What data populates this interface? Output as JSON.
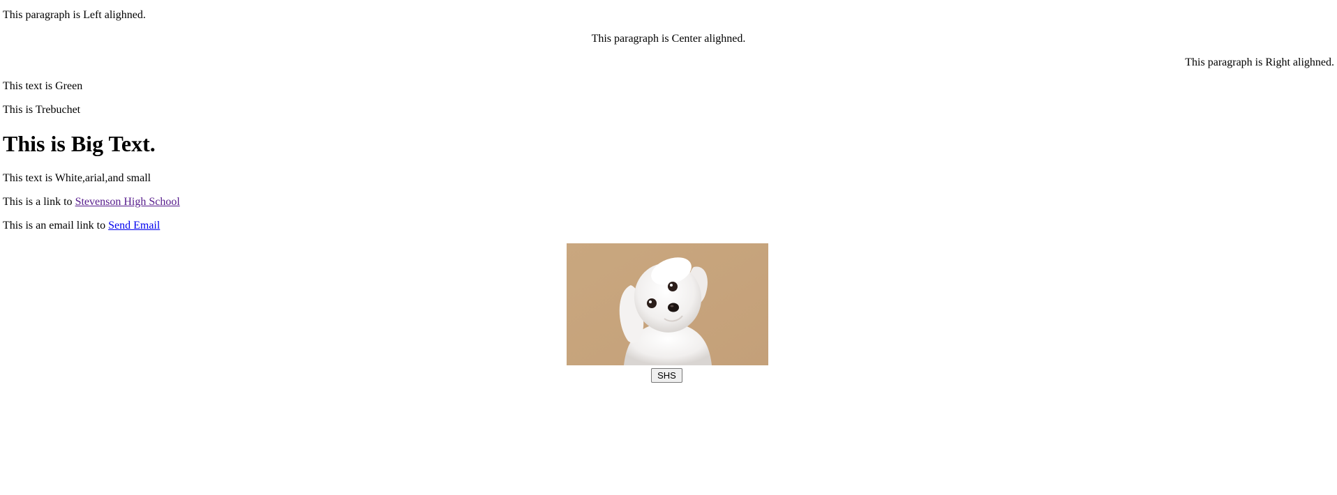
{
  "paragraphs": {
    "left": "This paragraph is Left alighned.",
    "center": "This paragraph is Center alighned.",
    "right": "This paragraph is Right alighned.",
    "green": "This text is Green",
    "trebuchet": "This is Trebuchet",
    "white_arial_small": "This text is White,arial,and small"
  },
  "heading": {
    "big_text": "This is Big Text."
  },
  "link_line": {
    "prefix": "This is a link to ",
    "link_text": "Stevenson High School",
    "link_color": "#551a8b"
  },
  "email_line": {
    "prefix": "This is an email link to ",
    "link_text": "Send Email",
    "link_color": "#0000ee"
  },
  "image": {
    "subject": "white-puppy-photo",
    "background_color": "#c8a67e"
  },
  "button": {
    "label": "SHS"
  }
}
